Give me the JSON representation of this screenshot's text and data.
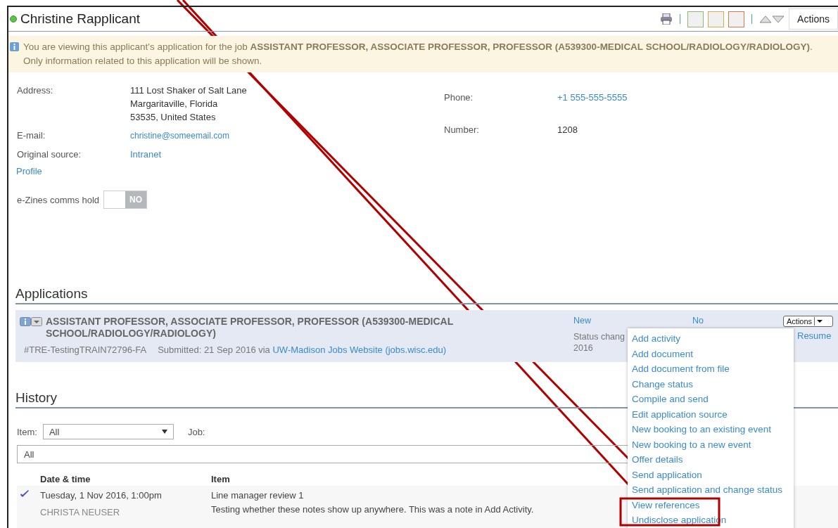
{
  "header": {
    "title": "Christine Rapplicant",
    "online": true,
    "actions_label": "Actions"
  },
  "flags": [
    {
      "color": "#8dbb6e"
    },
    {
      "color": "#dcaa4a"
    },
    {
      "color": "#e0774a"
    }
  ],
  "notice": {
    "text": "You are viewing this applicant's application for the job **ASSISTANT PROFESSOR, ASSOCIATE PROFESSOR, PROFESSOR (A539300-MEDICAL SCHOOL/RADIOLOGY/RADIOLOGY)**. Only information related to this application will be shown."
  },
  "details_left": [
    {
      "label": "Address:",
      "lines": [
        "111 Lost Shaker of Salt Lane",
        "Margaritaville, Florida",
        "53535, United States"
      ],
      "kind": "text"
    },
    {
      "label": "E-mail:",
      "lines": [
        "christine@someemail.com"
      ],
      "kind": "email"
    },
    {
      "label": "Original source:",
      "lines": [
        "Intranet"
      ],
      "kind": "link"
    }
  ],
  "details_right": [
    {
      "label": "Phone:",
      "value": "+1 555-555-5555",
      "kind": "link"
    },
    {
      "label": "Number:",
      "value": "1208",
      "kind": "text"
    }
  ],
  "profile_link": "Profile",
  "comms_hold": {
    "label": "e-Zines comms hold",
    "value_label": "NO",
    "on": false
  },
  "applications": {
    "heading": "Applications",
    "items": [
      {
        "title": "ASSISTANT PROFESSOR, ASSOCIATE PROFESSOR, PROFESSOR (A539300-MEDICAL SCHOOL/RADIOLOGY/RADIOLOGY)",
        "reference": "#TRE-TestingTRAIN72796-FA",
        "submitted": "Submitted: 21 Sep 2016 via",
        "source_link": "UW-Madison Jobs Website (jobs.wisc.edu)",
        "status": "New",
        "status_note": [
          "Status chang",
          "2016"
        ],
        "flag": "No",
        "actions_label": "Actions",
        "resume_link": "Resume"
      }
    ]
  },
  "actions_menu": {
    "items": [
      "Add activity",
      "Add document",
      "Add document from file",
      "Change status",
      "Compile and send",
      "Edit application source",
      "New booking to an existing event",
      "New booking to a new event",
      "Offer details",
      "Send application",
      "Send application and change status",
      "View references",
      "Undisclose application"
    ]
  },
  "history": {
    "heading": "History",
    "item_filter": {
      "label": "Item:",
      "value": "All"
    },
    "job_filter": {
      "label": "Job:",
      "value": "All"
    },
    "columns": [
      "Date & time",
      "Item"
    ],
    "rows": [
      {
        "done": true,
        "date": "Tuesday, 1 Nov 2016, 1:00pm",
        "person": "CHRISTA NEUSER",
        "title": "Line manager review 1",
        "note": "Testing whether these notes show up anywhere. This was a note in Add Activity."
      }
    ]
  }
}
